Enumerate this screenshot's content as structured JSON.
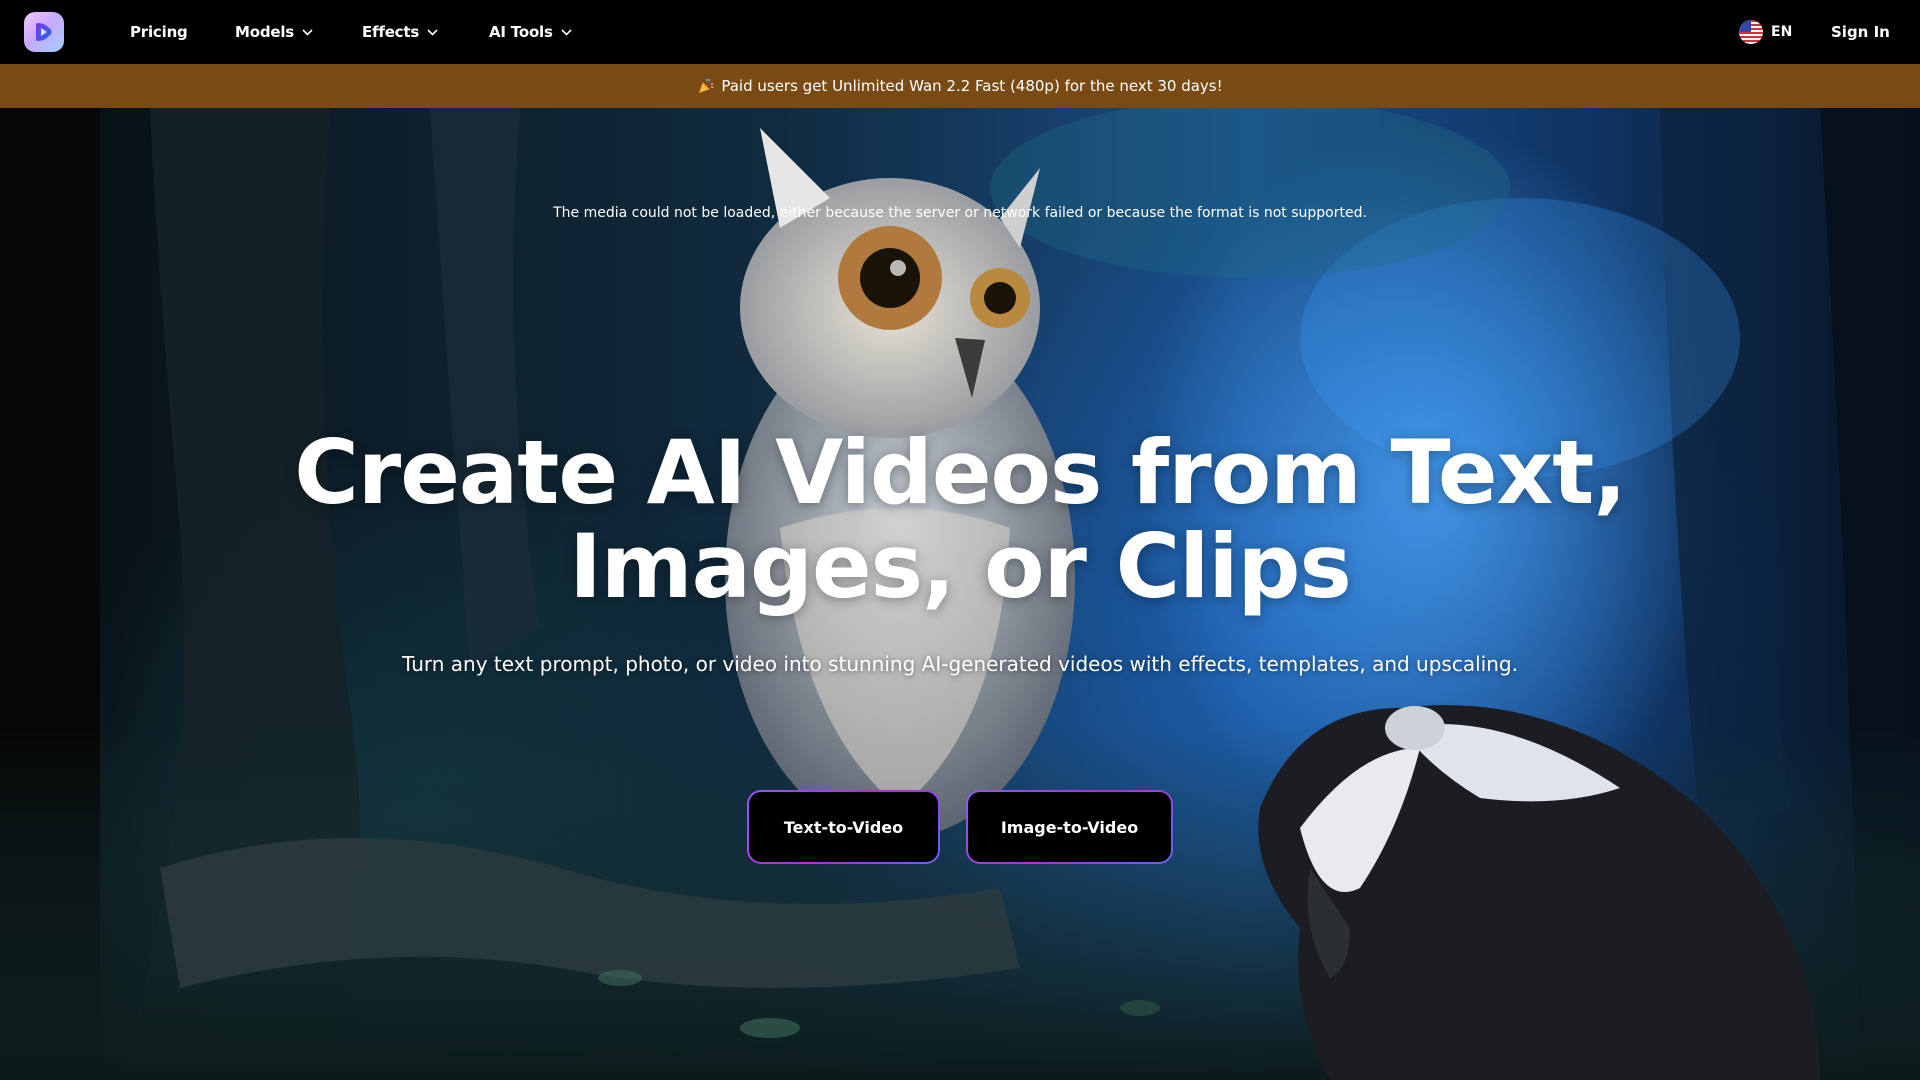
{
  "nav": {
    "items": [
      {
        "label": "Pricing",
        "has_dropdown": false
      },
      {
        "label": "Models",
        "has_dropdown": true
      },
      {
        "label": "Effects",
        "has_dropdown": true
      },
      {
        "label": "AI Tools",
        "has_dropdown": true
      }
    ],
    "language": "EN",
    "sign_in": "Sign In"
  },
  "banner": {
    "icon": "party-popper-icon",
    "text": "Paid users get Unlimited Wan 2.2 Fast (480p) for the next 30 days!",
    "background": "#7a4a14"
  },
  "hero": {
    "media_error": "The media could not be loaded, either because the server or network failed or because the format is not supported.",
    "headline_line1": "Create AI Videos from Text,",
    "headline_line2": "Images, or Clips",
    "subheadline": "Turn any text prompt, photo, or video into stunning AI-generated videos with effects, templates, and upscaling.",
    "buttons": [
      {
        "label": "Text-to-Video"
      },
      {
        "label": "Image-to-Video"
      }
    ]
  },
  "colors": {
    "nav_bg": "#000000",
    "button_bg": "#000000",
    "button_border_gradient": [
      "#8b5cf6",
      "#c026d3",
      "#6366f1"
    ]
  }
}
